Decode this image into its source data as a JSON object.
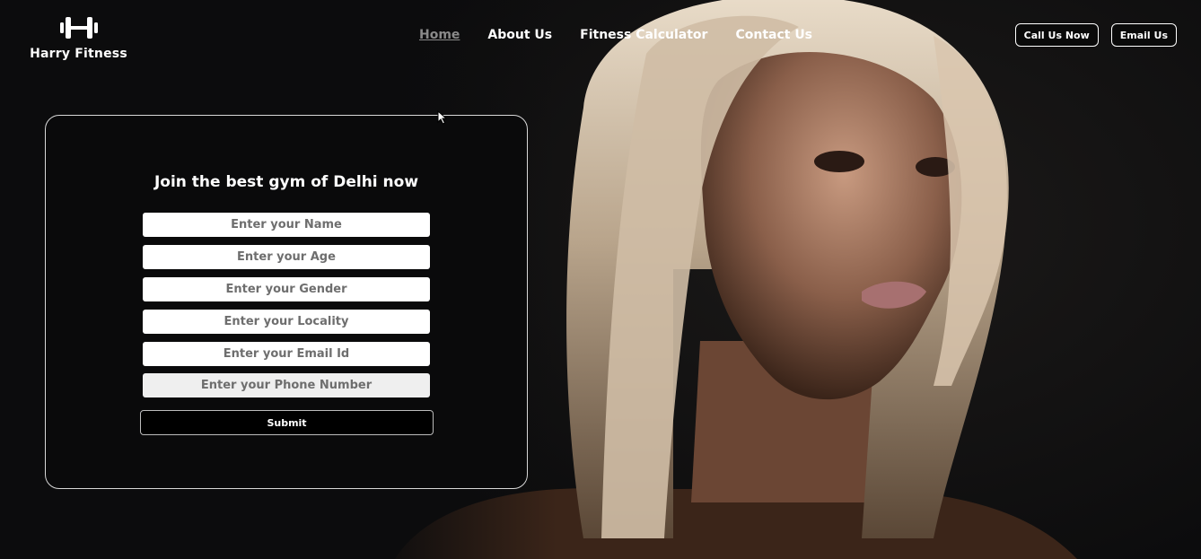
{
  "brand": {
    "name": "Harry Fitness",
    "icon": "dumbbell-icon"
  },
  "nav": {
    "items": [
      {
        "label": "Home",
        "active": true
      },
      {
        "label": "About Us",
        "active": false
      },
      {
        "label": "Fitness Calculator",
        "active": false
      },
      {
        "label": "Contact Us",
        "active": false
      }
    ]
  },
  "header_buttons": {
    "call_label": "Call Us Now",
    "email_label": "Email Us"
  },
  "form": {
    "title": "Join the best gym of Delhi now",
    "fields": [
      {
        "placeholder": "Enter your Name",
        "value": ""
      },
      {
        "placeholder": "Enter your Age",
        "value": ""
      },
      {
        "placeholder": "Enter your Gender",
        "value": ""
      },
      {
        "placeholder": "Enter your Locality",
        "value": ""
      },
      {
        "placeholder": "Enter your Email Id",
        "value": ""
      },
      {
        "placeholder": "Enter your Phone Number",
        "value": ""
      }
    ],
    "submit_label": "Submit"
  },
  "colors": {
    "background": "#0c0c0d",
    "text": "#ffffff",
    "nav_active": "#8a8a8a",
    "card_border": "#d8d8d8"
  }
}
